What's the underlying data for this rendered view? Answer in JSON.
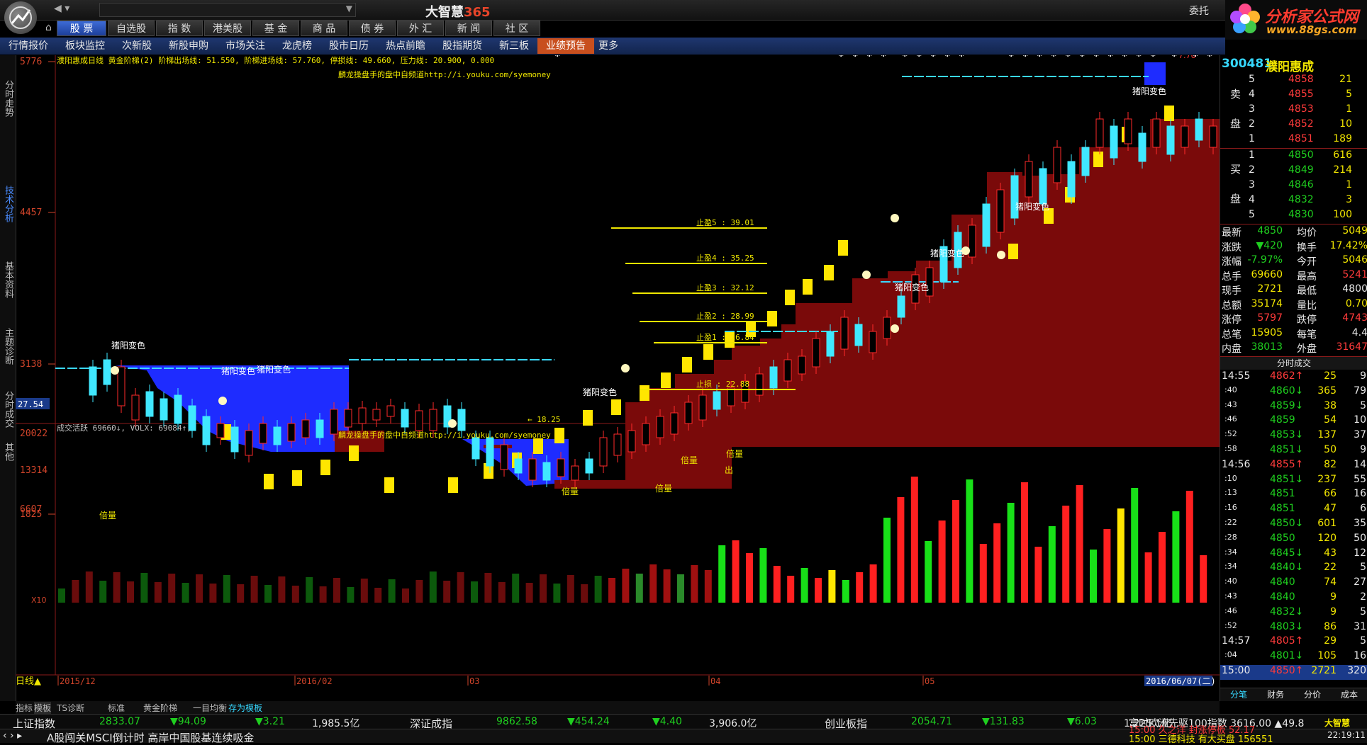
{
  "titlebar": {
    "title_main": "大智慧",
    "title_num": "365",
    "entrust": "委托",
    "brand_cn": "分析家公式网",
    "brand_url": "www.88gs.com"
  },
  "markets": [
    {
      "label": "股 票",
      "active": true
    },
    {
      "label": "自选股"
    },
    {
      "label": "指 数"
    },
    {
      "label": "港美股"
    },
    {
      "label": "基 金"
    },
    {
      "label": "商 品"
    },
    {
      "label": "债 券"
    },
    {
      "label": "外 汇"
    },
    {
      "label": "新 闻"
    },
    {
      "label": "社 区"
    }
  ],
  "subnav": [
    "行情报价",
    "板块监控",
    "次新股",
    "新股申购",
    "市场关注",
    "龙虎榜",
    "股市日历",
    "热点前瞻",
    "股指期货",
    "新三板",
    "业绩预告",
    "更多"
  ],
  "lefttabs": [
    "分时走势",
    "技术分析",
    "基本资料",
    "主题诊断",
    "分时成交",
    "其他"
  ],
  "chart": {
    "header": "濮阳惠成日线  黄金阶梯(2) 阶梯出场线: 51.550, 阶梯进场线: 57.760, 停损线: 49.660, 压力线: 20.900, 0.000",
    "watermark": "麟龙操盘手的盘中自频道http://i.youku.com/syemoney",
    "yaxis": [
      "5776",
      "4457",
      "3138",
      "1825"
    ],
    "cur_price": "27.54",
    "stops": [
      {
        "label": "止盈5  : 39.01"
      },
      {
        "label": "止盈4  : 35.25"
      },
      {
        "label": "止盈3  : 32.12"
      },
      {
        "label": "止盈2  : 28.99"
      },
      {
        "label": "止盈1  : 26.84"
      },
      {
        "label": "止损  : 22.88"
      }
    ],
    "low_label": "← 18.25",
    "tags": [
      "猪阳变色",
      "猪阳变色",
      "猪阳变色",
      "猪阳变色",
      "猪阳变色",
      "猪阳变色",
      "猪阳变色",
      "猪阳变色"
    ],
    "top_label": "7.76",
    "vol_header": "成交活跃 69660↓, VOLX: 69084↑,",
    "vol_yaxis": [
      "20022",
      "13314",
      "6607"
    ],
    "vol_x10": "X10",
    "vol_tags": [
      "倍量",
      "倍量",
      "倍量",
      "倍量",
      "倍量",
      "出"
    ],
    "xaxis": {
      "left": "日线▲",
      "dates": [
        "2015/12",
        "2016/02",
        "03",
        "04",
        "05"
      ],
      "current": "2016/06/07(二)"
    }
  },
  "stock": {
    "code": "300481",
    "name": "濮阳惠成"
  },
  "orderbook": {
    "sell_label": [
      "卖",
      "盘"
    ],
    "buy_label": [
      "买",
      "盘"
    ],
    "sell": [
      [
        "5",
        "4858",
        "21"
      ],
      [
        "4",
        "4855",
        "5"
      ],
      [
        "3",
        "4853",
        "1"
      ],
      [
        "2",
        "4852",
        "10"
      ],
      [
        "1",
        "4851",
        "189"
      ]
    ],
    "buy": [
      [
        "1",
        "4850",
        "616"
      ],
      [
        "2",
        "4849",
        "214"
      ],
      [
        "3",
        "4846",
        "1"
      ],
      [
        "4",
        "4832",
        "3"
      ],
      [
        "5",
        "4830",
        "100"
      ]
    ]
  },
  "stats": [
    [
      "最新",
      "4850",
      "均价",
      "5049"
    ],
    [
      "涨跌",
      "▼420",
      "换手",
      "17.42%"
    ],
    [
      "涨幅",
      "-7.97%",
      "今开",
      "5046"
    ],
    [
      "总手",
      "69660",
      "最高",
      "5241"
    ],
    [
      "现手",
      "2721",
      "最低",
      "4800"
    ],
    [
      "总额",
      "35174",
      "量比",
      "0.70"
    ],
    [
      "涨停",
      "5797",
      "跌停",
      "4743"
    ],
    [
      "总笔",
      "15905",
      "每笔",
      "4.4"
    ],
    [
      "内盘",
      "38013",
      "外盘",
      "31647"
    ]
  ],
  "ticks_title": "分时成交",
  "ticks": [
    [
      "14:55",
      "4862↑",
      "25",
      "9"
    ],
    [
      ":40",
      "4860↓",
      "365",
      "79"
    ],
    [
      ":43",
      "4859↓",
      "38",
      "5"
    ],
    [
      ":46",
      "4859",
      "54",
      "10"
    ],
    [
      ":52",
      "4853↓",
      "137",
      "37"
    ],
    [
      ":58",
      "4851↓",
      "50",
      "9"
    ],
    [
      "14:56",
      "4855↑",
      "82",
      "14"
    ],
    [
      ":10",
      "4851↓",
      "237",
      "55"
    ],
    [
      ":13",
      "4851",
      "66",
      "16"
    ],
    [
      ":16",
      "4851",
      "47",
      "6"
    ],
    [
      ":22",
      "4850↓",
      "601",
      "35"
    ],
    [
      ":28",
      "4850",
      "120",
      "50"
    ],
    [
      ":34",
      "4845↓",
      "43",
      "12"
    ],
    [
      ":34",
      "4840↓",
      "22",
      "5"
    ],
    [
      ":40",
      "4840",
      "74",
      "27"
    ],
    [
      ":43",
      "4840",
      "9",
      "2"
    ],
    [
      ":46",
      "4832↓",
      "9",
      "5"
    ],
    [
      ":52",
      "4803↓",
      "86",
      "31"
    ],
    [
      "14:57",
      "4805↑",
      "29",
      "5"
    ],
    [
      ":04",
      "4801↓",
      "105",
      "16"
    ],
    [
      "15:00",
      "4850↑",
      "2721",
      "320"
    ]
  ],
  "rp_tabs": [
    "分笔",
    "财务",
    "分价",
    "成本"
  ],
  "bottom_tabs": [
    "指标",
    "模板",
    "TS诊断",
    "标准",
    "黄金阶梯",
    "一目均衡",
    "存为模板"
  ],
  "indices": [
    {
      "name": "上证指数",
      "v": "2833.07",
      "c": "▼94.09",
      "p": "▼3.21",
      "a": "1,985.5亿"
    },
    {
      "name": "深证成指",
      "v": "9862.58",
      "c": "▼454.24",
      "p": "▼4.40",
      "a": "3,906.0亿"
    },
    {
      "name": "创业板指",
      "v": "2054.71",
      "c": "▼131.83",
      "p": "▼6.03",
      "a": "1,225.1亿"
    }
  ],
  "index_extra": "富时欧洲先驱100指数 3616.00 ▲49.8",
  "ticker": {
    "text": "A股闯关MSCI倒计时 高岸中国股基连续吸金",
    "line1": "15:00 久之洋  封涨停板 52.17",
    "line2": "15:00 三德科技 有大买盘 156551",
    "time": "22:19:11",
    "brand": "大智慧"
  }
}
